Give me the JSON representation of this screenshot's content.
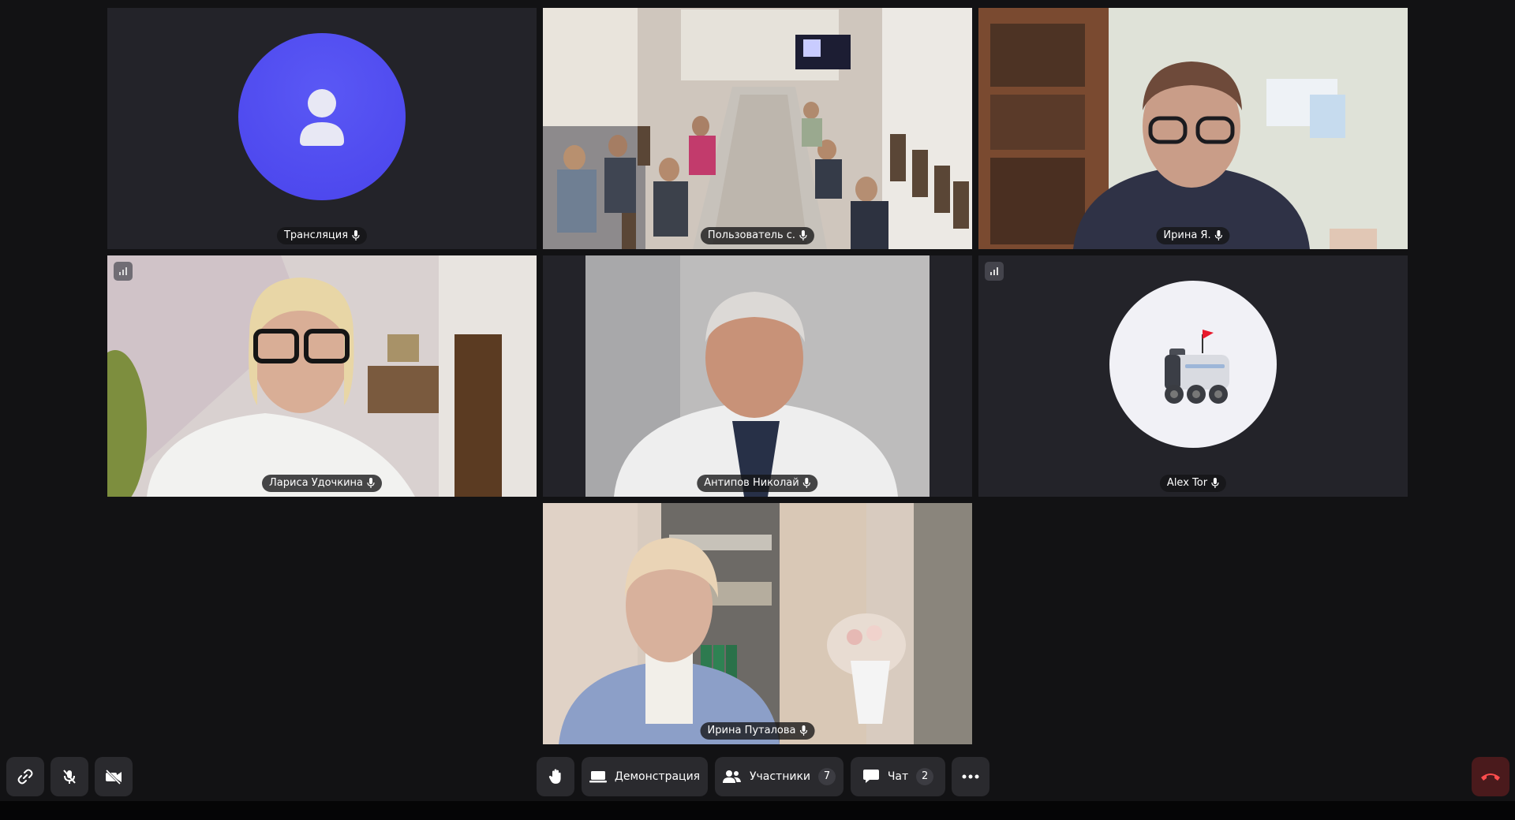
{
  "participants": [
    {
      "name": "Трансляция",
      "avatar": "user-placeholder-icon",
      "avatar_color": "#4f4cf0"
    },
    {
      "name": "Пользователь с.",
      "video": "conference-room"
    },
    {
      "name": "Ирина Я.",
      "video": "webcam-office"
    },
    {
      "name": "Лариса Удочкина",
      "video": "webcam-home"
    },
    {
      "name": "Антипов Николай",
      "video": "webcam-doctor"
    },
    {
      "name": "Alex Tor",
      "avatar": "delivery-robot-icon",
      "avatar_color": "#f1f1f6"
    },
    {
      "name": "Ирина Путалова",
      "video": "webcam-office-shelves"
    }
  ],
  "toolbar": {
    "demo_label": "Демонстрация",
    "participants_label": "Участники",
    "participants_count": "7",
    "chat_label": "Чат",
    "chat_count": "2"
  },
  "colors": {
    "background": "#121214",
    "tile": "#232329",
    "button": "#2a2a2e",
    "end_call": "#4a1a1c",
    "end_icon": "#ff4d4d"
  }
}
